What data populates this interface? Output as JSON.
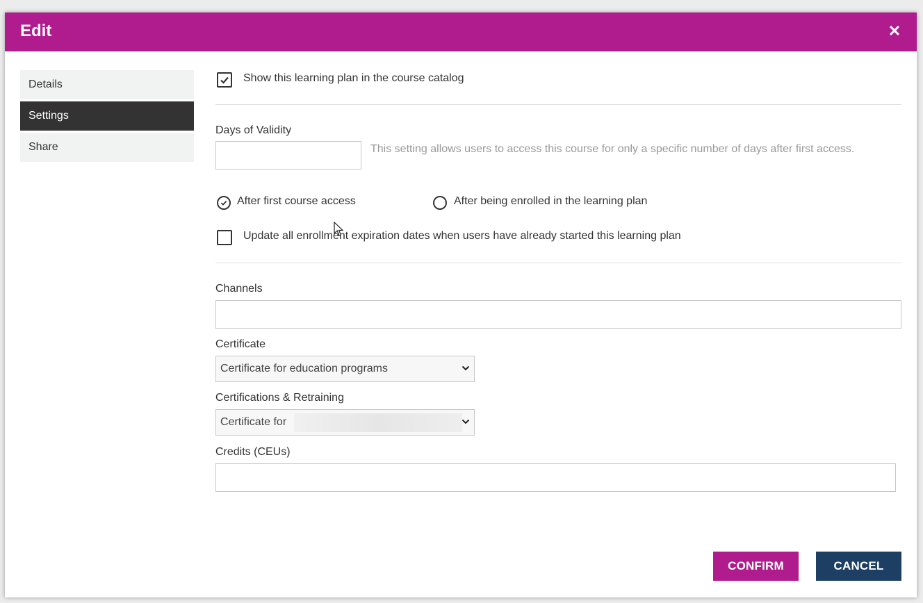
{
  "modal": {
    "title": "Edit",
    "close_icon": "close-icon",
    "accent_color": "#b01c8e"
  },
  "sidebar": {
    "items": [
      {
        "label": "Details",
        "active": false
      },
      {
        "label": "Settings",
        "active": true
      },
      {
        "label": "Share",
        "active": false
      }
    ]
  },
  "settings": {
    "show_in_catalog": {
      "label": "Show this learning plan in the course catalog",
      "checked": true
    },
    "days_of_validity": {
      "label": "Days of Validity",
      "value": "",
      "hint": "This setting allows users to access this course for only a specific number of days after first access."
    },
    "validity_start": {
      "options": [
        {
          "label": "After first course access",
          "selected": true
        },
        {
          "label": "After being enrolled in the learning plan",
          "selected": false
        }
      ]
    },
    "update_expiration": {
      "label": "Update all enrollment expiration dates when users have already started this learning plan",
      "checked": false
    },
    "channels": {
      "label": "Channels",
      "value": ""
    },
    "certificate": {
      "label": "Certificate",
      "selected": "Certificate for education programs"
    },
    "retraining": {
      "label": "Certifications & Retraining",
      "selected": "Certificate for"
    },
    "credits": {
      "label": "Credits (CEUs)",
      "value": ""
    }
  },
  "footer": {
    "confirm_label": "CONFIRM",
    "cancel_label": "CANCEL",
    "confirm_color": "#b01c8e",
    "cancel_color": "#1c3f63"
  }
}
